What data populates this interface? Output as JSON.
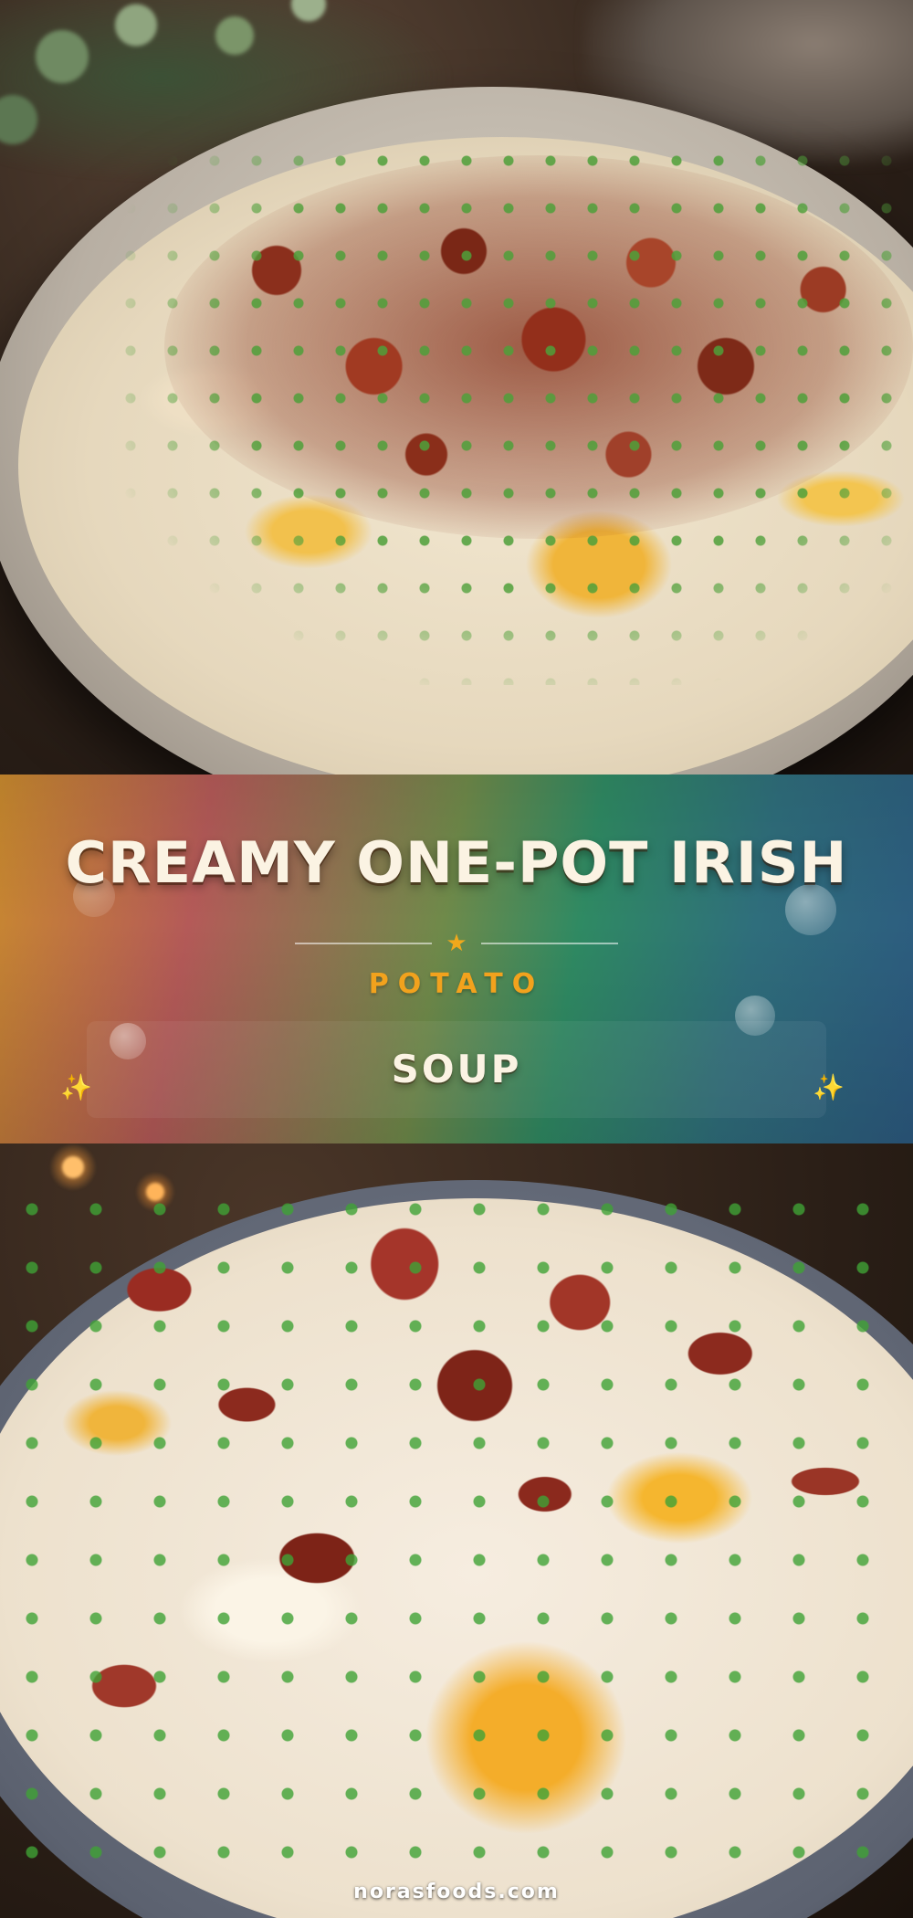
{
  "banner": {
    "title": "CREAMY ONE-POT IRISH",
    "subtitle": "POTATO",
    "title2": "SOUP",
    "star_glyph": "★",
    "sparkle_glyph": "✨",
    "colors": {
      "title": "#fbf3e3",
      "subtitle": "#f2a21d",
      "star": "#f0a81c"
    }
  },
  "images": {
    "top": "potato soup topped with bacon, cheddar and chives in a speckled bowl",
    "bottom": "close-up of potato soup with bacon, melted cheddar and chives"
  },
  "footer": {
    "watermark": "norasfoods.com"
  }
}
